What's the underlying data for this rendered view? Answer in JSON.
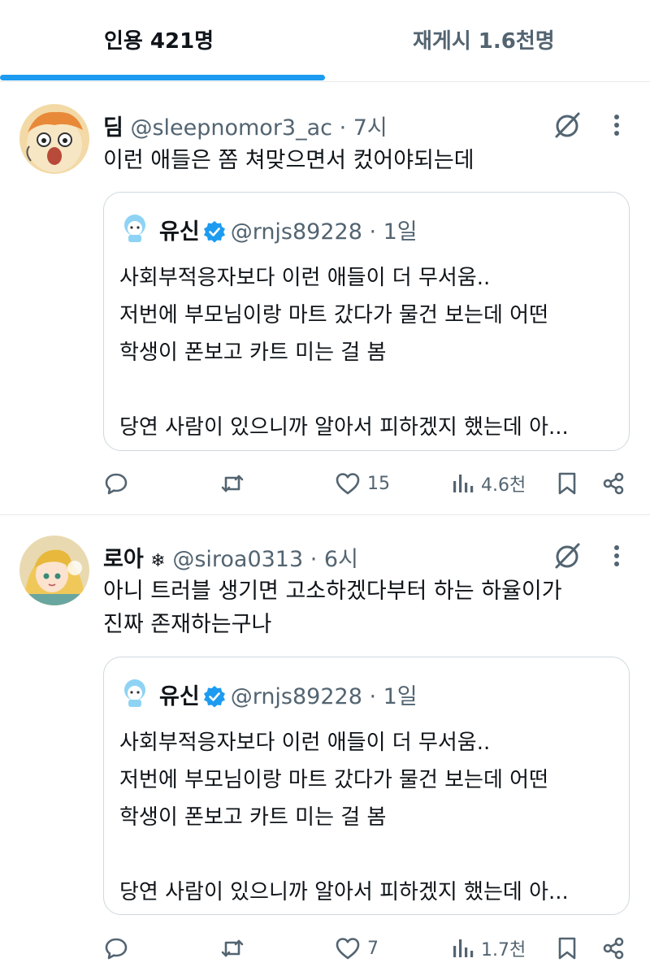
{
  "tabs": [
    {
      "label": "인용 421명",
      "active": true
    },
    {
      "label": "재게시 1.6천명",
      "active": false
    }
  ],
  "colors": {
    "accent": "#1d9bf0",
    "text": "#0f1419",
    "muted": "#536471",
    "border": "#cfd9de"
  },
  "posts": [
    {
      "name": "딤",
      "badge": "",
      "handle_time": "@sleepnomor3_ac · 7시",
      "text_lines": [
        "이런 애들은 쫌 쳐맞으면서 컸어야되는데"
      ],
      "quote": {
        "name": "유신",
        "handle_time": "@rnjs89228 · 1일",
        "lines": [
          "사회부적응자보다 이런 애들이 더 무서움..",
          "저번에 부모님이랑 마트 갔다가 물건 보는데 어떤",
          "학생이 폰보고 카트 미는 걸 봄",
          "",
          "당연 사람이 있으니까 알아서 피하겠지 했는데 아..."
        ]
      },
      "actions": {
        "reply": "",
        "repost": "",
        "likes": "15",
        "views": "4.6천"
      }
    },
    {
      "name": "로아",
      "badge": "❄",
      "handle_time": "@siroa0313 · 6시",
      "text_lines": [
        "아니 트러블 생기면 고소하겠다부터 하는 하율이가",
        "진짜 존재하는구나"
      ],
      "quote": {
        "name": "유신",
        "handle_time": "@rnjs89228 · 1일",
        "lines": [
          "사회부적응자보다 이런 애들이 더 무서움..",
          "저번에 부모님이랑 마트 갔다가 물건 보는데 어떤",
          "학생이 폰보고 카트 미는 걸 봄",
          "",
          "당연 사람이 있으니까 알아서 피하겠지 했는데 아..."
        ]
      },
      "actions": {
        "reply": "",
        "repost": "",
        "likes": "7",
        "views": "1.7천"
      }
    }
  ],
  "icons": [
    "grok-icon",
    "more-icon",
    "verified-icon",
    "reply-icon",
    "repost-icon",
    "like-icon",
    "views-icon",
    "bookmark-icon",
    "share-icon"
  ]
}
